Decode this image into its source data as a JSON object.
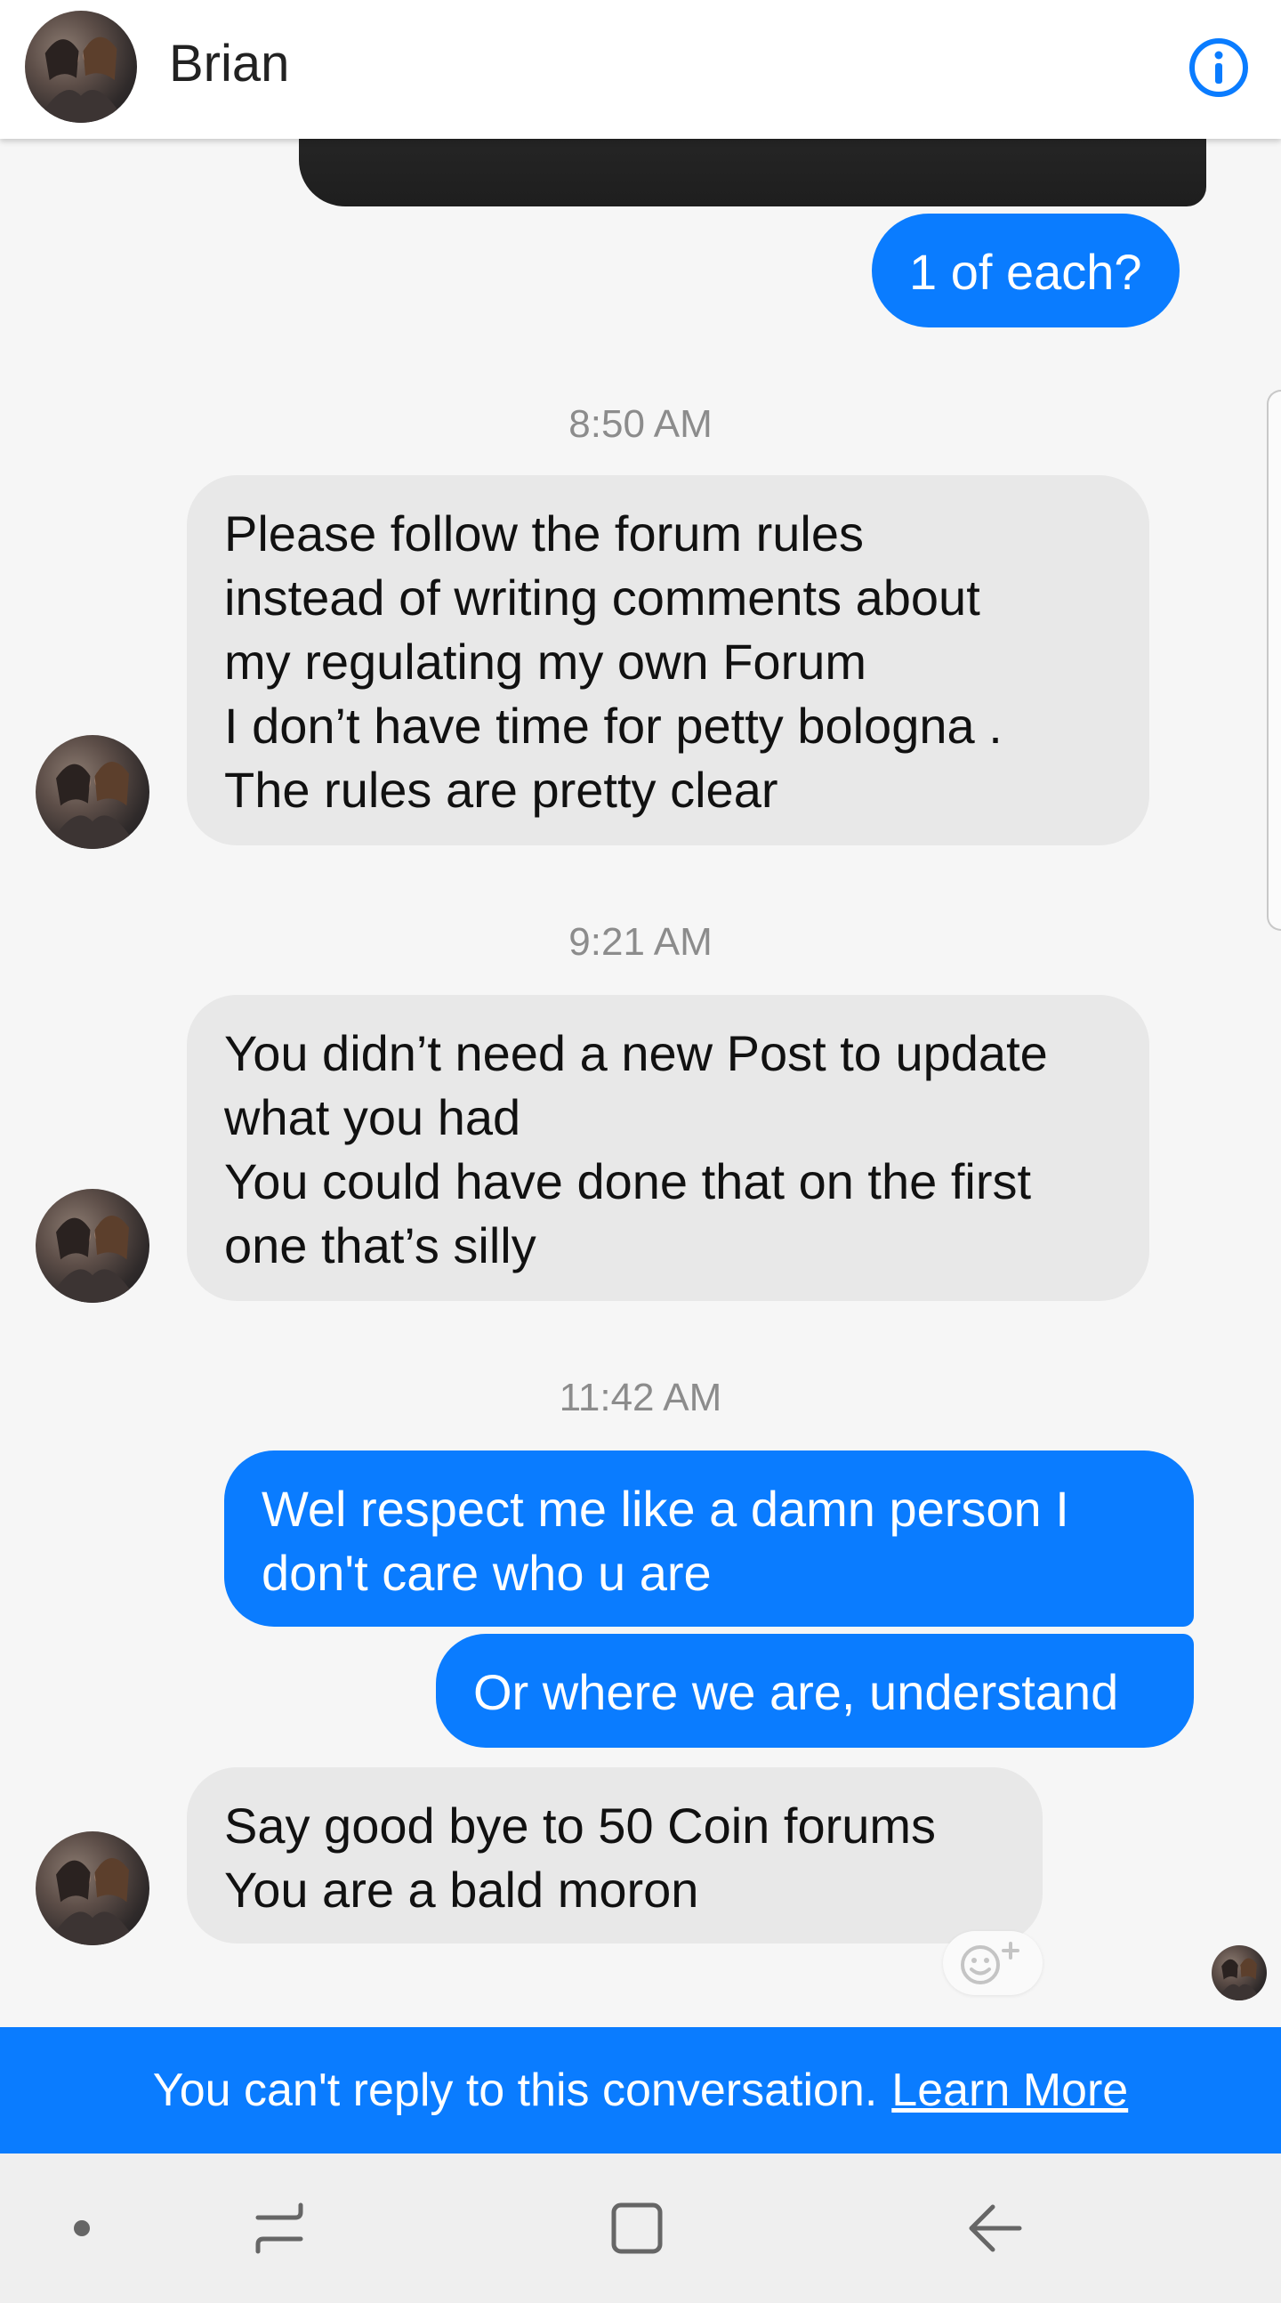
{
  "header": {
    "contact_name": "Brian",
    "avatar_icon": "profile-photo",
    "info_icon": "info-icon"
  },
  "messages": [
    {
      "type": "outgoing",
      "text": "1 of each?"
    },
    {
      "type": "timestamp",
      "text": "8:50 AM"
    },
    {
      "type": "incoming",
      "text": "Please follow the forum rules\ninstead of writing comments about\nmy regulating my own Forum\nI don’t have time for petty bologna .\nThe rules are pretty clear"
    },
    {
      "type": "timestamp",
      "text": "9:21 AM"
    },
    {
      "type": "incoming",
      "text": "You didn’t need a new Post to update\nwhat you had\nYou could have done that on the first\none that’s silly"
    },
    {
      "type": "timestamp",
      "text": "11:42 AM"
    },
    {
      "type": "outgoing",
      "text": "Wel respect me like a damn person I\ndon't care who u are"
    },
    {
      "type": "outgoing",
      "text": "Or where we are, understand"
    },
    {
      "type": "incoming",
      "text": "Say good bye to 50 Coin forums\nYou are a bald moron"
    }
  ],
  "banner": {
    "text": "You can't reply to this conversation.",
    "link": "Learn More"
  },
  "colors": {
    "accent": "#0a7cff",
    "incoming_bubble": "#e8e8e8",
    "background": "#f6f6f6"
  },
  "navbar": {
    "icons": [
      "dot-icon",
      "recent-apps-icon",
      "home-icon",
      "back-icon"
    ]
  }
}
